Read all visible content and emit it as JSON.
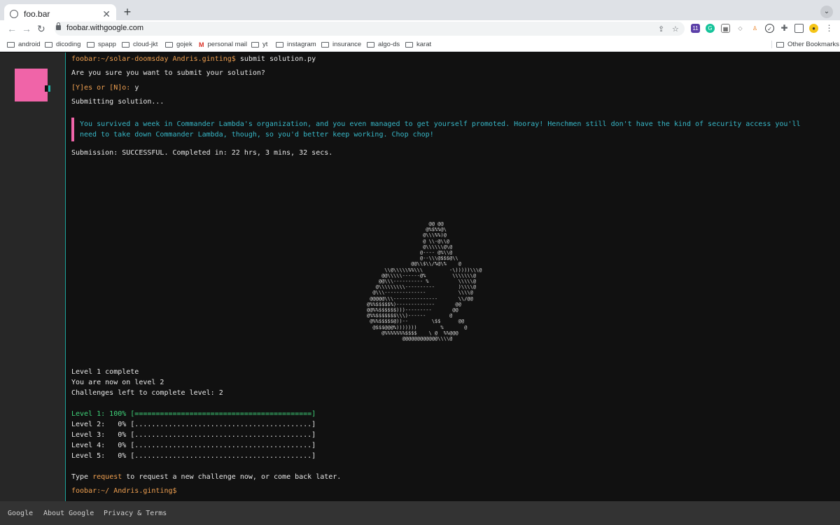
{
  "browser": {
    "tab_title": "foo.bar",
    "url": "foobar.withgoogle.com",
    "bookmarks": [
      "android",
      "dicoding",
      "spapp",
      "cloud-jkt",
      "gojek",
      "personal mail",
      "yt",
      "instagram",
      "insurance",
      "algo-ds",
      "karat"
    ],
    "other_bookmarks": "Other Bookmarks",
    "extension_badge": "11"
  },
  "terminal": {
    "prompt1": "foobar:~/solar-doomsday Andris.ginting$",
    "command": " submit solution.py",
    "confirm_q": "Are you sure you want to submit your solution?",
    "confirm_opts": "[Y]es or [N]o:",
    "confirm_ans": " y",
    "submitting": "Submitting solution...",
    "notice": "You survived a week in Commander Lambda's organization, and you even managed to get yourself promoted. Hooray! Henchmen still don't have the kind of security access you'll need to take down Commander Lambda, though, so you'd better keep working. Chop chop!",
    "result": "Submission: SUCCESSFUL. Completed in: 22 hrs, 3 mins, 32 secs.",
    "level_complete": "Level 1 complete",
    "now_level": "You are now on level 2",
    "challenges_left": "Challenges left to complete level: 2",
    "levels": [
      {
        "text": "Level 1: 100% [==========================================]",
        "progress": 1.0
      },
      {
        "text": "Level 2:   0% [..........................................]",
        "progress": 0
      },
      {
        "text": "Level 3:   0% [..........................................]",
        "progress": 0
      },
      {
        "text": "Level 4:   0% [..........................................]",
        "progress": 0
      },
      {
        "text": "Level 5:   0% [..........................................]",
        "progress": 0
      }
    ],
    "type_pre": "Type ",
    "type_cmd": "request",
    "type_post": " to request a new challenge now, or come back later.",
    "prompt2": "foobar:~/ Andris.ginting$",
    "ascii_art": "                     @@ @@\n                    @%$%%@\\\n                   @\\\\\\%%)@\n                   @ \\\\-@\\\\@\n                   @\\\\\\\\\\\\@\\@\n                  @---- @%\\\\@\n                  @--\\\\\\@$$$@\\\\\n               @@\\\\$\\\\/%@\\%    @\n      \\\\@\\\\\\\\\\%%\\\\\\         -\\)))))\\\\\\@\n     @@\\\\\\\\\\------@%         \\\\\\\\\\\\\\@\n    @@\\\\\\---------- %          \\\\\\\\\\@\n   @\\\\\\\\\\\\\\\\\\----------        )\\\\\\\\@\n  @\\\\\\--------------           \\\\\\\\@\n @@@@@\\\\\\---------------       \\\\/@@\n@%%$$$$$%)-------------       @@\n@@%%$$$$$$)))---------       @@\n@%%$$$$$$$\\\\\\)------        @\n @%%$$$$$@))--        \\$$      @@\n  @$$$@@@%)))))))        %       @\n     @%%%%%%%$$$$    \\ @  %%@@@\n            @@@@@@@@@@@@\\\\\\\\@"
  },
  "footer": {
    "links": [
      "Google",
      "About Google",
      "Privacy & Terms"
    ]
  },
  "colors": {
    "terminal_bg": "#111111",
    "prompt": "#f0a050",
    "notice_text": "#37b8c8",
    "notice_bar": "#f064a8",
    "success_level": "#3fd47a",
    "avatar": "#f064a8"
  }
}
